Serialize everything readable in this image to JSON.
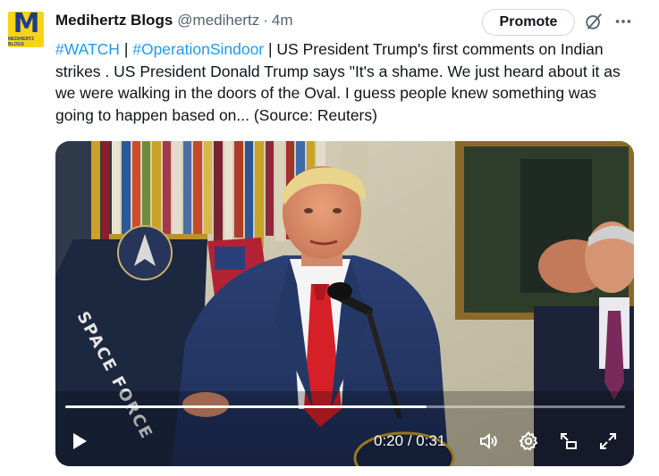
{
  "tweet": {
    "author_name": "Medihertz Blogs",
    "handle": "@medihertz",
    "separator": "·",
    "time_ago": "4m",
    "promote_label": "Promote",
    "avatar_letter": "M",
    "avatar_subtext": "MEDIHERTZ BLOGS",
    "hashtag_1": "#WATCH",
    "sep_1": " | ",
    "hashtag_2": "#OperationSindoor",
    "body_text": " | US President Trump's first comments on Indian strikes .  US President Donald Trump says \"It's a shame. We just heard about it as we were walking in the doors of the Oval. I guess people knew something was going to happen based on... (Source: Reuters)",
    "icons": [
      "grok-icon",
      "more-icon"
    ]
  },
  "video": {
    "current_time": "0:20",
    "duration": "0:31",
    "time_separator": " / ",
    "progress_fraction": 0.645,
    "flag_text": "SPACE FORCE",
    "icons": [
      "play-icon",
      "volume-icon",
      "settings-icon",
      "picture-in-picture-icon",
      "fullscreen-icon"
    ]
  },
  "colors": {
    "link": "#1d9bf0",
    "text_primary": "#0f1419",
    "text_secondary": "#536471",
    "avatar_bg": "#f7d417",
    "avatar_fg": "#1e3c8c"
  }
}
